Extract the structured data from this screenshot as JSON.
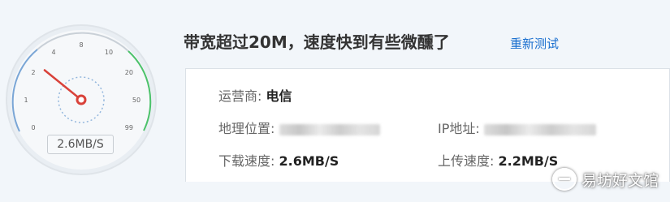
{
  "gauge": {
    "ticks": [
      "0",
      "1",
      "2",
      "4",
      "8",
      "10",
      "20",
      "50",
      "99"
    ],
    "readout": "2.6MB/S",
    "unit": "MB/s",
    "needle_value": 2.6
  },
  "headline": "带宽超过20M，速度快到有些微醺了",
  "retest_label": "重新测试",
  "details": {
    "isp_label": "运营商:",
    "isp_value": "电信",
    "location_label": "地理位置:",
    "ip_label": "IP地址:",
    "download_label": "下载速度:",
    "download_value": "2.6MB/S",
    "upload_label": "上传速度:",
    "upload_value": "2.2MB/S"
  },
  "watermark": "易坊好文馆",
  "colors": {
    "accent_link": "#1a6fcf",
    "needle": "#d9423a",
    "gauge_low_arc": "#7aa6d6",
    "gauge_high_arc": "#4cc26a"
  }
}
